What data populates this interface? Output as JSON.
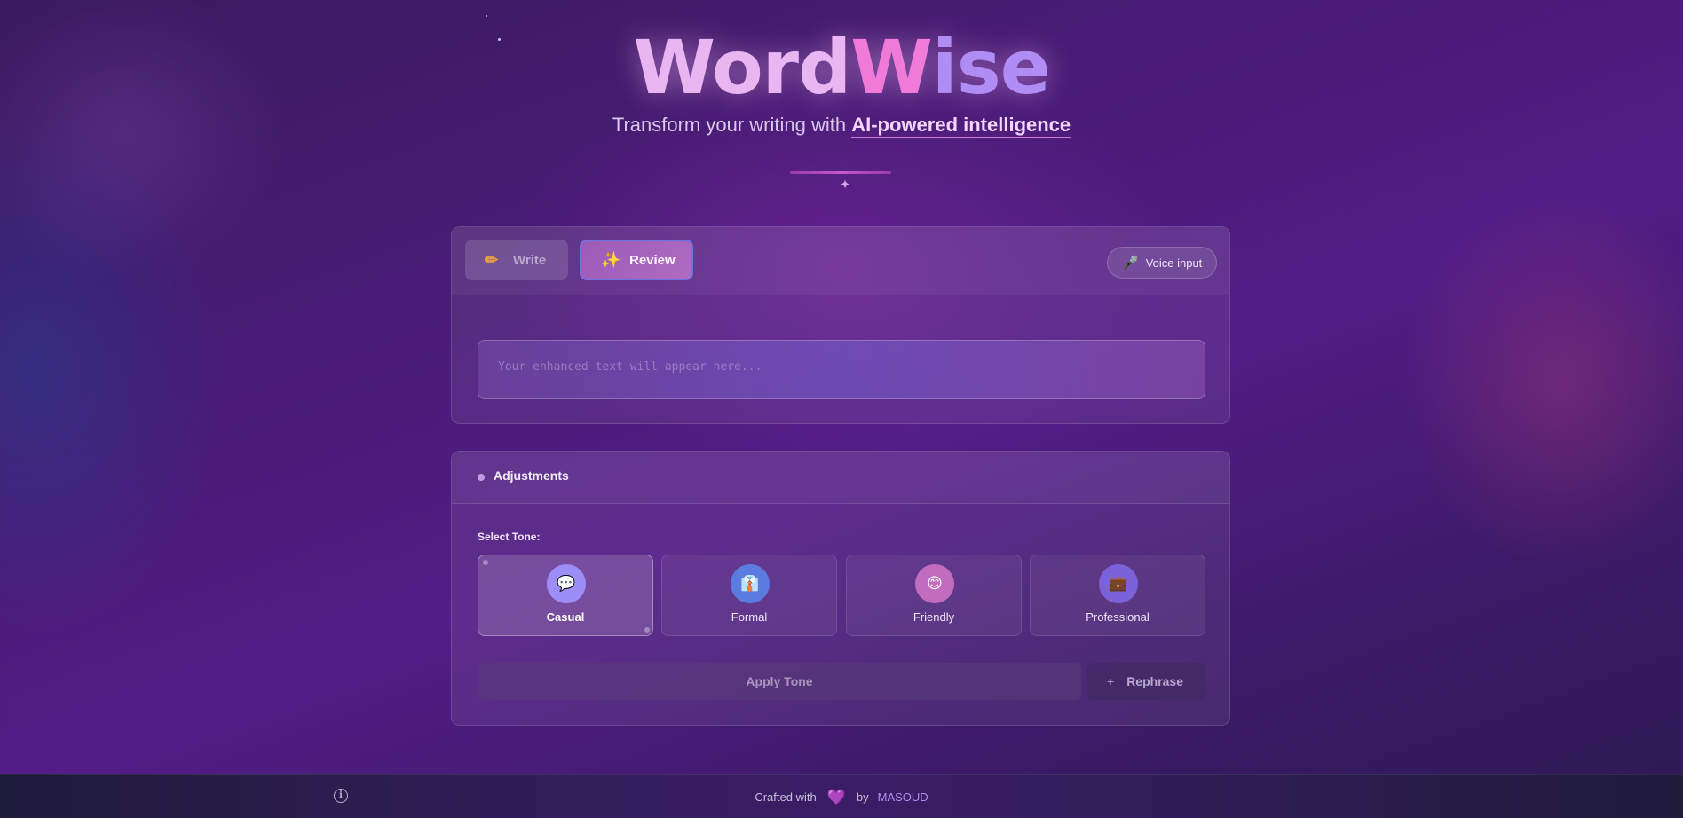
{
  "header": {
    "title_a": "Word",
    "title_b": "W",
    "title_c": "ise",
    "subtitle_prefix": "Transform your writing with ",
    "subtitle_highlight": "AI-powered intelligence",
    "sparkle_glyph": "✦"
  },
  "tabs": {
    "write_label": "Write",
    "review_label": "Review",
    "active": "Review",
    "write_icon": "✏",
    "review_icon": "✨"
  },
  "voice": {
    "label": "Voice input",
    "icon": "🎤"
  },
  "output": {
    "placeholder": "Your enhanced text will appear here..."
  },
  "adjustments": {
    "title": "Adjustments",
    "select_label": "Select Tone:",
    "tones": [
      {
        "label": "Casual",
        "icon": "💬",
        "color": "#9c8df7"
      },
      {
        "label": "Formal",
        "icon": "👔",
        "color": "#5b7be0"
      },
      {
        "label": "Friendly",
        "icon": "😊",
        "color": "#c26cc0"
      },
      {
        "label": "Professional",
        "icon": "💼",
        "color": "#7b62d8"
      }
    ],
    "selected_tone": "Casual",
    "apply_label": "Apply Tone",
    "rephrase_label": "Rephrase",
    "rephrase_icon": "+"
  },
  "footer": {
    "info_glyph": "i",
    "crafted_prefix": "Crafted with",
    "heart_icon": "💜",
    "by_text": "by",
    "author": "MASOUD"
  }
}
